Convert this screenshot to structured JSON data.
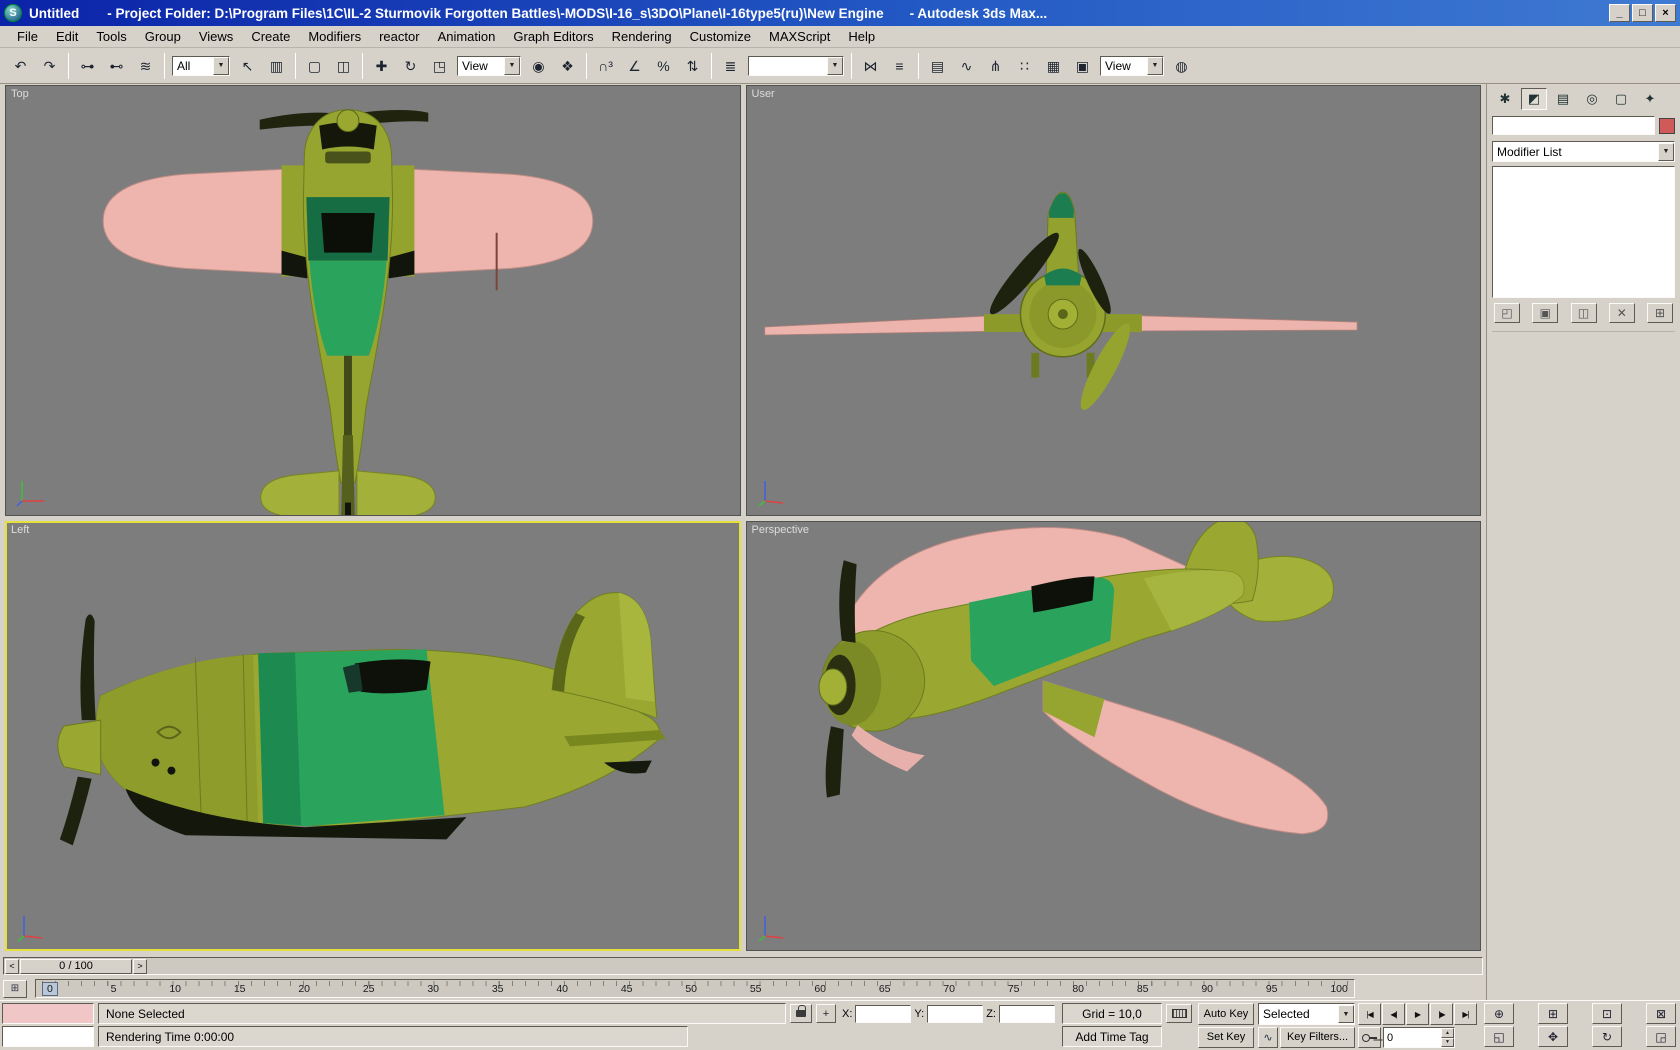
{
  "ui": {
    "dropdown_arrow": "▼",
    "spinner_up": "▲",
    "spinner_down": "▼"
  },
  "colors": {
    "titlebar_start": "#0b23a8",
    "titlebar_end": "#3f7ad2",
    "ui_gray": "#d6d2ca",
    "viewport_bg": "#7d7d7d",
    "active_viewport_border": "#e6e13a",
    "plane_olive": "#96a430",
    "plane_pink": "#edb5ae",
    "plane_green": "#2aa35d",
    "plane_dark_green": "#166d43",
    "object_color_swatch": "#d05a5a"
  },
  "titlebar": {
    "app_initial": "S",
    "document_title": "Untitled",
    "project_path": "- Project Folder: D:\\Program Files\\1C\\IL-2 Sturmovik Forgotten Battles\\-MODS\\I-16_s\\3DO\\Plane\\I-16type5(ru)\\New Engine",
    "app_name": "- Autodesk 3ds Max...",
    "minimize_glyph": "_",
    "maximize_glyph": "□",
    "close_glyph": "×"
  },
  "menus": [
    "File",
    "Edit",
    "Tools",
    "Group",
    "Views",
    "Create",
    "Modifiers",
    "reactor",
    "Animation",
    "Graph Editors",
    "Rendering",
    "Customize",
    "MAXScript",
    "Help"
  ],
  "toolbar": {
    "filter_value": "All",
    "coord_value": "View",
    "render_view_value": "View",
    "named_selection_value": "",
    "group_a": [
      {
        "name": "undo",
        "glyph": "↶"
      },
      {
        "name": "redo",
        "glyph": "↷"
      }
    ],
    "group_b": [
      {
        "name": "select-and-link",
        "glyph": "⊶"
      },
      {
        "name": "unlink-selection",
        "glyph": "⊷"
      },
      {
        "name": "bind-to-space-warp",
        "glyph": "≋"
      }
    ],
    "group_c": [
      {
        "name": "select-object",
        "glyph": "↖"
      },
      {
        "name": "select-by-name",
        "glyph": "▥"
      }
    ],
    "group_d": [
      {
        "name": "rectangular-selection-region",
        "glyph": "▢"
      },
      {
        "name": "window-crossing-toggle",
        "glyph": "◫"
      }
    ],
    "group_e": [
      {
        "name": "select-and-move",
        "glyph": "✚"
      },
      {
        "name": "select-and-rotate",
        "glyph": "↻"
      },
      {
        "name": "select-and-scale",
        "glyph": "◳"
      }
    ],
    "group_f": [
      {
        "name": "use-pivot-point-center",
        "glyph": "◉"
      },
      {
        "name": "select-and-manipulate",
        "glyph": "❖"
      }
    ],
    "group_g": [
      {
        "name": "snaps-toggle",
        "glyph": "∩³"
      },
      {
        "name": "angle-snap-toggle",
        "glyph": "∠"
      },
      {
        "name": "percent-snap-toggle",
        "glyph": "%"
      },
      {
        "name": "spinner-snap-toggle",
        "glyph": "⇅"
      }
    ],
    "group_h": [
      {
        "name": "edit-named-selection-sets",
        "glyph": "≣"
      }
    ],
    "group_i": [
      {
        "name": "mirror",
        "glyph": "⋈"
      },
      {
        "name": "align",
        "glyph": "≡"
      }
    ],
    "group_j": [
      {
        "name": "layer-manager",
        "glyph": "▤"
      },
      {
        "name": "curve-editor",
        "glyph": "∿"
      },
      {
        "name": "schematic-view",
        "glyph": "⋔"
      },
      {
        "name": "material-editor",
        "glyph": "∷"
      },
      {
        "name": "render-scene",
        "glyph": "▦"
      },
      {
        "name": "render-type",
        "glyph": "▣"
      }
    ],
    "group_k": [
      {
        "name": "quick-render",
        "glyph": "◍"
      }
    ]
  },
  "viewports": {
    "top": "Top",
    "user": "User",
    "left": "Left",
    "perspective": "Perspective"
  },
  "command_panel": {
    "tabs": [
      {
        "name": "create",
        "glyph": "✱"
      },
      {
        "name": "modify",
        "glyph": "◩"
      },
      {
        "name": "hierarchy",
        "glyph": "▤"
      },
      {
        "name": "motion",
        "glyph": "◎"
      },
      {
        "name": "display",
        "glyph": "▢"
      },
      {
        "name": "utilities",
        "glyph": "✦"
      }
    ],
    "object_name_value": "",
    "modifier_list_label": "Modifier List",
    "stack_tools": [
      {
        "name": "pin-stack",
        "glyph": "◰"
      },
      {
        "name": "show-end-result",
        "glyph": "▣"
      },
      {
        "name": "make-unique",
        "glyph": "◫"
      },
      {
        "name": "remove-modifier",
        "glyph": "✕"
      },
      {
        "name": "configure-modifier-sets",
        "glyph": "⊞"
      }
    ]
  },
  "timeline": {
    "prev_arrow": "<",
    "next_arrow": ">",
    "slider_value": "0 / 100",
    "mini_curve_glyph": "⊞",
    "ticks": [
      "0",
      "5",
      "10",
      "15",
      "20",
      "25",
      "30",
      "35",
      "40",
      "45",
      "50",
      "55",
      "60",
      "65",
      "70",
      "75",
      "80",
      "85",
      "90",
      "95",
      "100"
    ]
  },
  "statusbar": {
    "prompt": "None Selected",
    "x_label": "X:",
    "y_label": "Y:",
    "z_label": "Z:",
    "grid_label": "Grid = 10,0",
    "add_time_tag": "Add Time Tag",
    "rendering_time": "Rendering Time 0:00:00",
    "auto_key_label": "Auto Key",
    "set_key_label": "Set Key",
    "set_key_selection_value": "Selected",
    "key_filters_label": "Key Filters...",
    "curve_glyph": "∿",
    "abs_toggle_glyph": "+",
    "frame_value": "0",
    "playback": [
      {
        "name": "go-to-start",
        "glyph": "|◀"
      },
      {
        "name": "previous-frame",
        "glyph": "◀|"
      },
      {
        "name": "play-animation",
        "glyph": "▶"
      },
      {
        "name": "next-frame",
        "glyph": "|▶"
      },
      {
        "name": "go-to-end",
        "glyph": "▶|"
      }
    ],
    "nav": [
      {
        "name": "zoom",
        "glyph": "⊕"
      },
      {
        "name": "zoom-all",
        "glyph": "⊞"
      },
      {
        "name": "zoom-extents",
        "glyph": "⊡"
      },
      {
        "name": "zoom-extents-all",
        "glyph": "⊠"
      },
      {
        "name": "zoom-region",
        "glyph": "◱"
      },
      {
        "name": "pan-view",
        "glyph": "✥"
      },
      {
        "name": "arc-rotate",
        "glyph": "↻"
      },
      {
        "name": "min-max-toggle",
        "glyph": "◲"
      }
    ]
  }
}
